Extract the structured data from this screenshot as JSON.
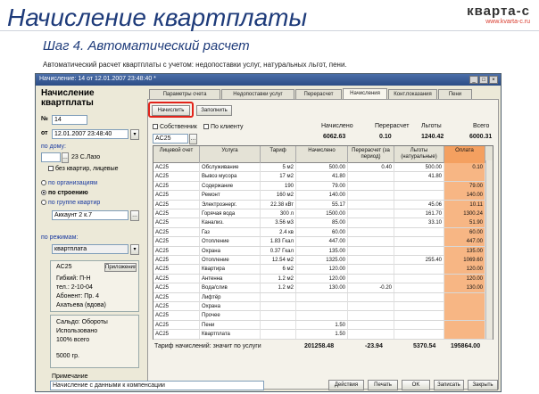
{
  "slide": {
    "title": "Начисление квартплаты",
    "subtitle": "Шаг 4.  Автоматический расчет",
    "description": "Автоматический расчет квартплаты с учетом: недопоставки услуг, натуральных льгот, пени.",
    "logo_text": "кварта-с",
    "logo_sub": "www.kvarta-c.ru"
  },
  "window": {
    "title": "Начисление: 14 от 12.01.2007 23:48:40 *",
    "buttons": [
      "_",
      "□",
      "×"
    ]
  },
  "left": {
    "heading_line1": "Начисление",
    "heading_line2": "квартплаты",
    "no_label": "№",
    "no_value": "14",
    "from_label": "от",
    "date_value": "12.01.2007 23:48:40",
    "by_house_label": "по дому:",
    "house_value": "23 С.Лазо",
    "empty_apts_label": "без квартир, лицевые",
    "radio1": "по организациям",
    "radio2": "по строению",
    "radio3": "по группе квартир",
    "apartment_value": "Аккаунт 2 к.7",
    "by_modes_label": "по режимам:",
    "mode_value": "квартплата",
    "debt_value": "AC25",
    "debt_btn": "Приложения",
    "info1": "Гибкий: П-Н",
    "info2": "тел.: 2-10-04",
    "info3": "Абонент: Пр. 4",
    "info4": "Ахатьева (вдова)",
    "summary1": "Сальдо: Обороты",
    "summary2": "Использовано",
    "summary3": "100% всего",
    "summary_value": "5000 гр.",
    "note_label": "Примечание",
    "note_value": "Начисление с данными к компенсации"
  },
  "tabs": [
    "Параметры счета",
    "Недопоставки услуг",
    "Перерасчет",
    "Начисления",
    "Конт.показания",
    "Пени"
  ],
  "active_tab": 3,
  "panel": {
    "calc_button": "Начислить",
    "fill_button": "Заполнить",
    "check1": "Собственник",
    "check2": "По клиенту",
    "service_value": "AC25",
    "top_labels": [
      "Начислено",
      "Перерасчет",
      "Льготы",
      "Всего"
    ],
    "top_values": [
      "6062.63",
      "0.10",
      "1240.42",
      "6000.31"
    ]
  },
  "table": {
    "headers": [
      "Лицевой счет",
      "Услуга",
      "Тариф",
      "Начислено",
      "Перерасчет (за период)",
      "Льготы (натуральные)",
      "Оплата"
    ],
    "rows": [
      [
        "AC25",
        "Обслуживание",
        "5 м2",
        "500.00",
        "0.40",
        "500.00",
        "0.10"
      ],
      [
        "AC25",
        "Вывоз мусора",
        "17 м2",
        "41.80",
        "",
        "41.80",
        ""
      ],
      [
        "AC25",
        "Содержание",
        "190",
        "79.00",
        "",
        "",
        "79.00"
      ],
      [
        "AC25",
        "Ремонт",
        "160 м2",
        "140.00",
        "",
        "",
        "140.00"
      ],
      [
        "AC25",
        "Электроэнерг.",
        "22.38 кВт",
        "55.17",
        "",
        "45.06",
        "10.11"
      ],
      [
        "AC25",
        "Горячая вода",
        "300 л",
        "1500.00",
        "",
        "161.70",
        "1300.24"
      ],
      [
        "AC25",
        "Канализ.",
        "3.56 м3",
        "85.00",
        "",
        "33.10",
        "51.90"
      ],
      [
        "AC25",
        "Газ",
        "2.4 кв",
        "60.00",
        "",
        "",
        "60.00"
      ],
      [
        "AC25",
        "Отопление",
        "1.83 Гкал",
        "447.00",
        "",
        "",
        "447.00"
      ],
      [
        "AC25",
        "Охрана",
        "0.37 Гкал",
        "135.00",
        "",
        "",
        "135.00"
      ],
      [
        "AC25",
        "Отопление",
        "12.54 м2",
        "1325.00",
        "",
        "255.40",
        "1069.60"
      ],
      [
        "AC25",
        "Квартира",
        "6 м2",
        "120.00",
        "",
        "",
        "120.00"
      ],
      [
        "AC25",
        "Антенна",
        "1.2 м2",
        "120.00",
        "",
        "",
        "120.00"
      ],
      [
        "AC25",
        "Вода/слив",
        "1.2 м2",
        "130.00",
        "-0.20",
        "",
        "130.00"
      ],
      [
        "AC25",
        "Лифтёр",
        "",
        "",
        "",
        "",
        ""
      ],
      [
        "AC25",
        "Охрана",
        "",
        "",
        "",
        "",
        ""
      ],
      [
        "AC25",
        "Прочее",
        "",
        "",
        "",
        "",
        ""
      ],
      [
        "AC25",
        "Пени",
        "",
        "1.50",
        "",
        "",
        ""
      ],
      [
        "AC25",
        "Квартплата",
        "",
        "1.50",
        "",
        "",
        ""
      ]
    ],
    "total_label": "Тариф начислений: значит по услуги",
    "totals": [
      "201258.48",
      "-23.94",
      "5370.54",
      "195864.00"
    ]
  },
  "bottom": {
    "action_button": "Действия",
    "print_button": "Печать",
    "ok_button": "OK",
    "write_button": "Записать",
    "close_button": "Закрыть"
  }
}
